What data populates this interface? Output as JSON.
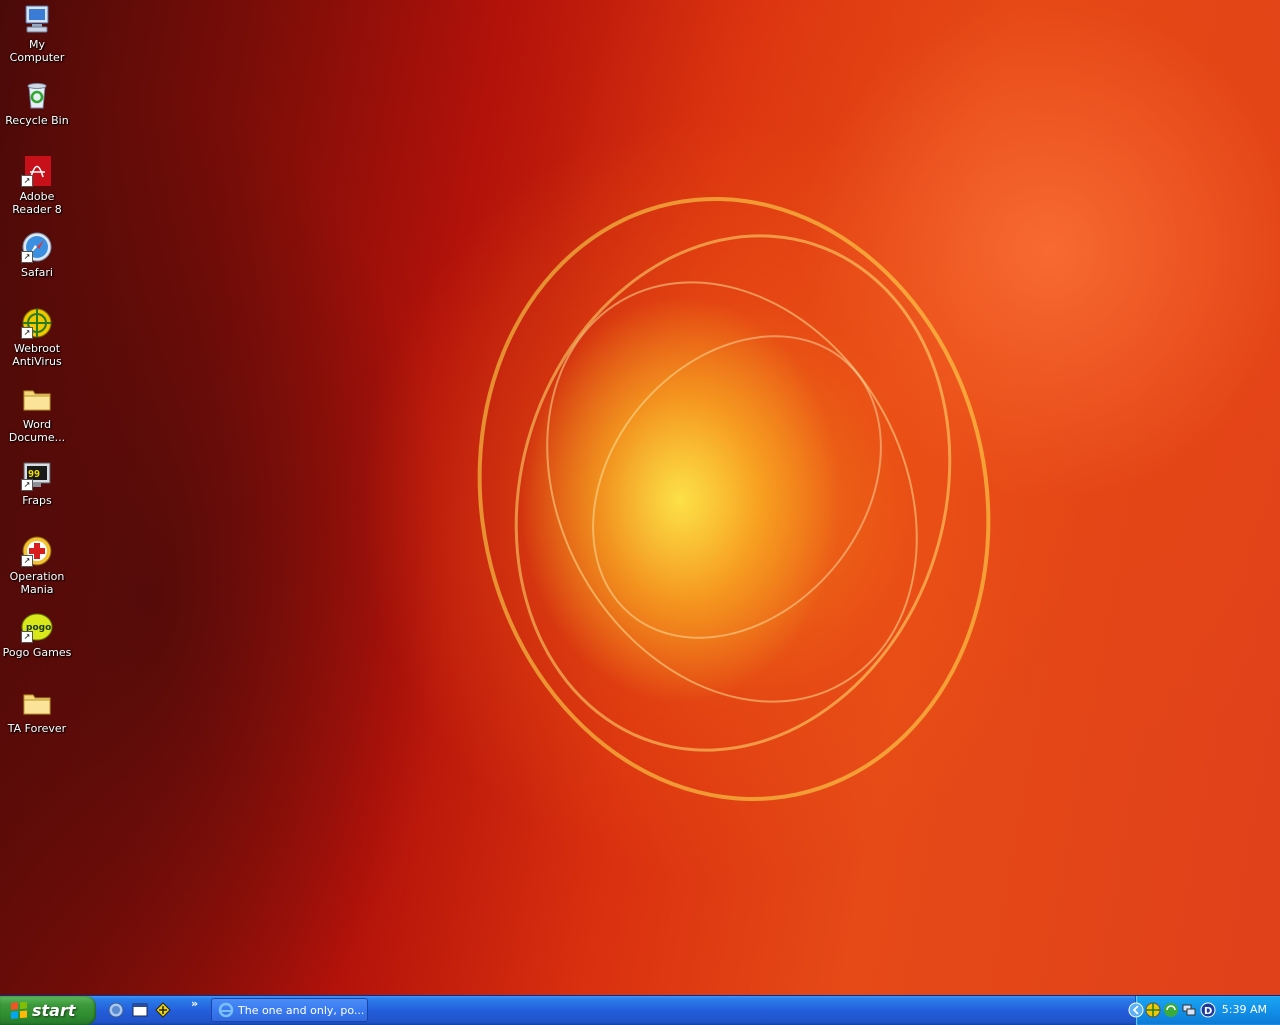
{
  "desktop": {
    "icons": [
      {
        "label": "My Computer",
        "icon": "my-computer-icon"
      },
      {
        "label": "Recycle Bin",
        "icon": "recycle-bin-icon"
      },
      {
        "label": "Adobe Reader 8",
        "icon": "adobe-reader-icon"
      },
      {
        "label": "Safari",
        "icon": "safari-icon"
      },
      {
        "label": "Webroot AntiVirus",
        "icon": "webroot-icon"
      },
      {
        "label": "Word Docume...",
        "icon": "folder-icon"
      },
      {
        "label": "Fraps",
        "icon": "fraps-icon"
      },
      {
        "label": "Operation Mania",
        "icon": "operation-mania-icon"
      },
      {
        "label": "Pogo Games",
        "icon": "pogo-icon"
      },
      {
        "label": "TA Forever",
        "icon": "folder-icon"
      }
    ]
  },
  "taskbar": {
    "start_label": "start",
    "quick_launch": [
      "ie-quicklaunch-icon",
      "show-desktop-icon",
      "app-quicklaunch-icon"
    ],
    "chevron": "»",
    "task_button_label": "The one and only, po...",
    "clock": "5:39 AM",
    "tray_icons": [
      "tray-collapse-icon",
      "webroot-tray-icon",
      "sync-tray-icon",
      "network-tray-icon",
      "d-tray-icon"
    ]
  }
}
